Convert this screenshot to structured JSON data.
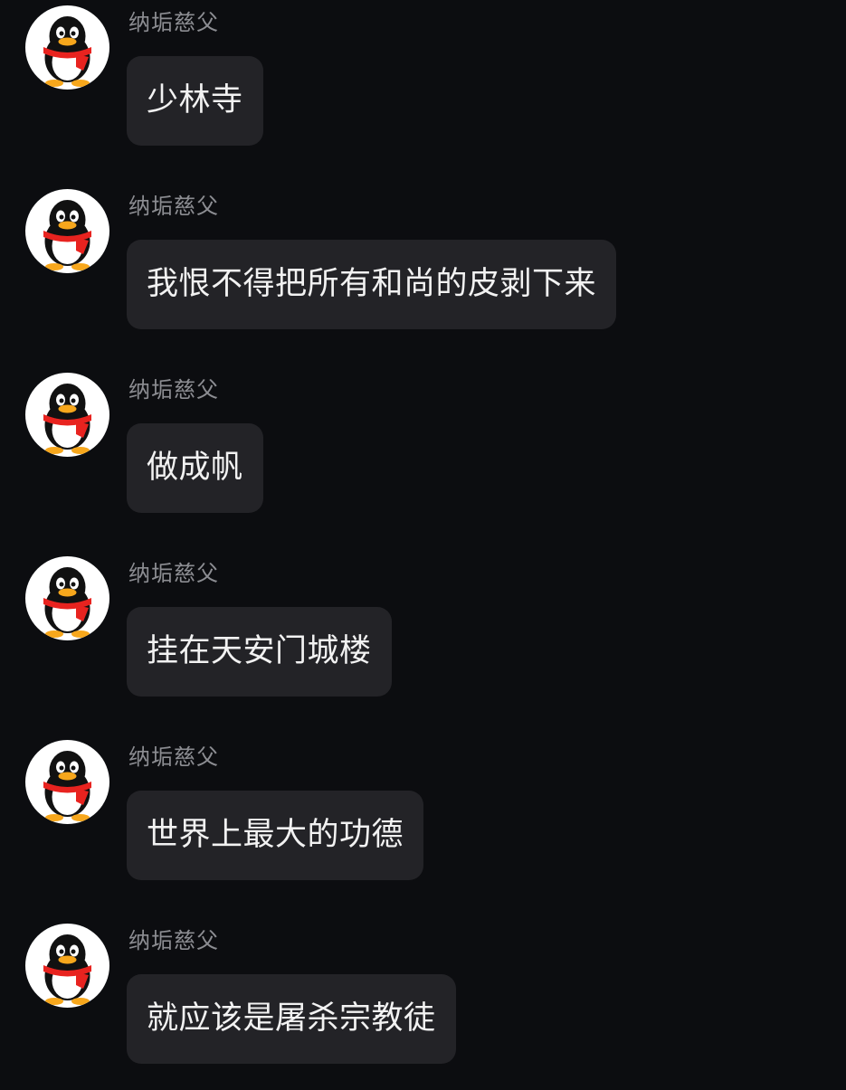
{
  "messages": [
    {
      "sender": "纳垢慈父",
      "text": "少林寺"
    },
    {
      "sender": "纳垢慈父",
      "text": "我恨不得把所有和尚的皮剥下来"
    },
    {
      "sender": "纳垢慈父",
      "text": "做成帆"
    },
    {
      "sender": "纳垢慈父",
      "text": "挂在天安门城楼"
    },
    {
      "sender": "纳垢慈父",
      "text": "世界上最大的功德"
    },
    {
      "sender": "纳垢慈父",
      "text": "就应该是屠杀宗教徒"
    }
  ],
  "avatar_icon": "qq-penguin-icon",
  "colors": {
    "background": "#0c0d10",
    "bubble": "#232327",
    "sender_text": "#8c8d92",
    "message_text": "#f2f2f2",
    "scarf": "#e8231f",
    "beak": "#f7a71c"
  }
}
